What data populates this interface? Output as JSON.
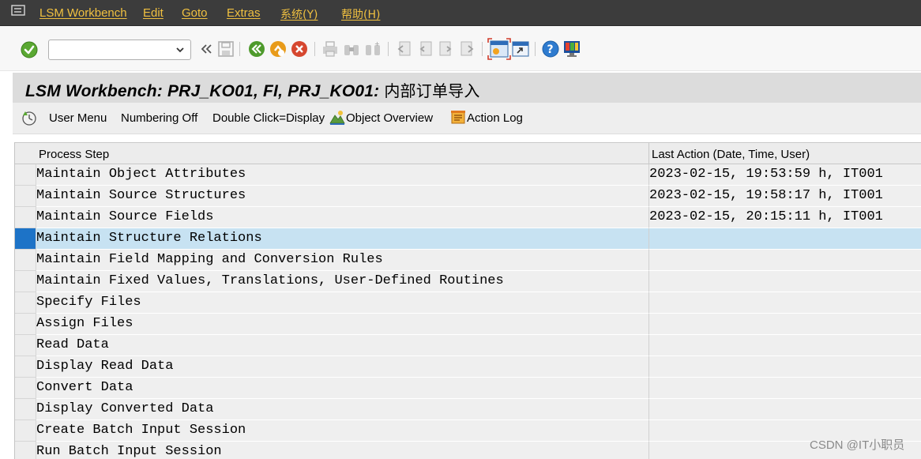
{
  "menubar": {
    "items": [
      "LSM Workbench",
      "Edit",
      "Goto",
      "Extras",
      "系统(Y)",
      "帮助(H)"
    ]
  },
  "toolbar": {
    "command_value": "",
    "icons": [
      "enter-icon",
      "back-icon",
      "save-icon",
      "back-green-icon",
      "exit-icon",
      "cancel-icon",
      "print-icon",
      "find-icon",
      "find-next-icon",
      "first-page-icon",
      "previous-page-icon",
      "next-page-icon",
      "last-page-icon",
      "create-session-icon",
      "shortcut-icon",
      "help-icon",
      "layout-icon"
    ]
  },
  "title": {
    "text": "LSM Workbench: PRJ_KO01, FI, PRJ_KO01: ",
    "text_cn": "内部订单导入"
  },
  "app_toolbar": {
    "user_menu": "User Menu",
    "numbering": "Numbering Off",
    "double_click": "Double Click=Display",
    "object_overview": "Object Overview",
    "action_log": "Action Log"
  },
  "table": {
    "headers": [
      "Process Step",
      "Last Action (Date, Time, User)"
    ],
    "rows": [
      {
        "step": "Maintain Object Attributes",
        "last": "2023-02-15, 19:53:59 h, IT001"
      },
      {
        "step": "Maintain Source Structures",
        "last": "2023-02-15, 19:58:17 h, IT001"
      },
      {
        "step": "Maintain Source Fields",
        "last": "2023-02-15, 20:15:11 h, IT001"
      },
      {
        "step": "Maintain Structure Relations",
        "last": ""
      },
      {
        "step": "Maintain Field Mapping and Conversion Rules",
        "last": ""
      },
      {
        "step": "Maintain Fixed Values, Translations, User-Defined Routines",
        "last": ""
      },
      {
        "step": "Specify Files",
        "last": ""
      },
      {
        "step": "Assign Files",
        "last": ""
      },
      {
        "step": "Read Data",
        "last": ""
      },
      {
        "step": "Display Read Data",
        "last": ""
      },
      {
        "step": "Convert Data",
        "last": ""
      },
      {
        "step": "Display Converted Data",
        "last": ""
      },
      {
        "step": "Create Batch Input Session",
        "last": ""
      },
      {
        "step": "Run Batch Input Session",
        "last": ""
      }
    ],
    "selected_index": 3
  },
  "watermark": "CSDN @IT小职员"
}
